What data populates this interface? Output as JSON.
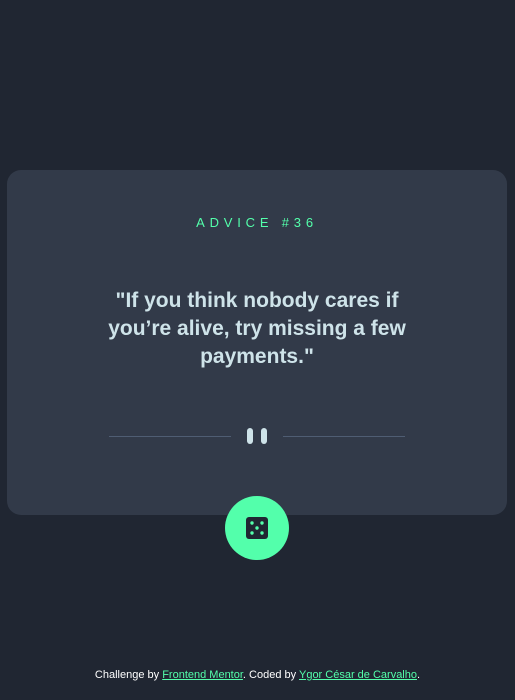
{
  "card": {
    "advice_label": "ADVICE #36",
    "quote": "\"If you think nobody cares if you’re alive, try missing a few payments.\""
  },
  "divider": {
    "icon": "pause-icon"
  },
  "dice_button": {
    "icon": "dice-icon"
  },
  "footer": {
    "prefix": "Challenge by ",
    "link1": "Frontend Mentor",
    "middle": ". Coded by ",
    "link2": "Ygor César de Carvalho",
    "suffix": "."
  },
  "colors": {
    "background": "#202632",
    "card": "#323a49",
    "accent": "#53ffab",
    "text": "#cee3e9",
    "divider": "#4f5d73"
  }
}
